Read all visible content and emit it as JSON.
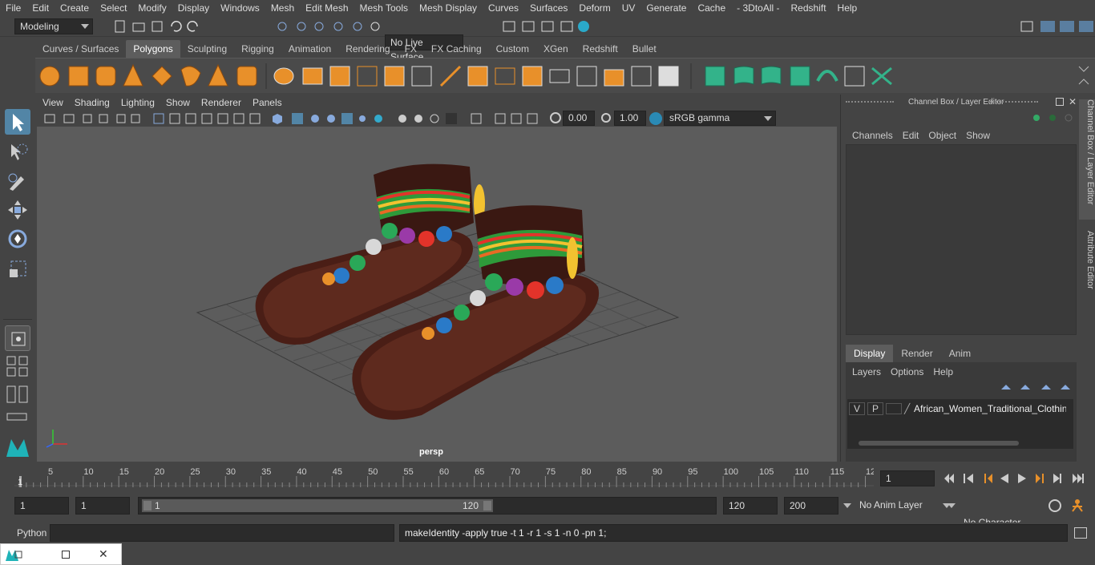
{
  "menubar": {
    "items": [
      "File",
      "Edit",
      "Create",
      "Select",
      "Modify",
      "Display",
      "Windows",
      "Mesh",
      "Edit Mesh",
      "Mesh Tools",
      "Mesh Display",
      "Curves",
      "Surfaces",
      "Deform",
      "UV",
      "Generate",
      "Cache",
      "- 3DtoAll -",
      "Redshift",
      "Help"
    ]
  },
  "status": {
    "mode": "Modeling",
    "live_surface": "No Live Surface"
  },
  "shelf": {
    "tabs": [
      "Curves / Surfaces",
      "Polygons",
      "Sculpting",
      "Rigging",
      "Animation",
      "Rendering",
      "FX",
      "FX Caching",
      "Custom",
      "XGen",
      "Redshift",
      "Bullet"
    ],
    "active_tab": "Polygons"
  },
  "panel": {
    "menus": [
      "View",
      "Shading",
      "Lighting",
      "Show",
      "Renderer",
      "Panels"
    ],
    "exposure": "0.00",
    "gamma": "1.00",
    "colorspace": "sRGB gamma",
    "camera_label": "persp"
  },
  "channel_box": {
    "title": "Channel Box / Layer Editor",
    "menus": [
      "Channels",
      "Edit",
      "Object",
      "Show"
    ],
    "tabs": [
      "Display",
      "Render",
      "Anim"
    ],
    "active_tab": "Display",
    "layer_menus": [
      "Layers",
      "Options",
      "Help"
    ],
    "layer": {
      "v": "V",
      "p": "P",
      "name": "African_Women_Traditional_Clothing"
    }
  },
  "side_tabs": {
    "channel": "Channel Box / Layer Editor",
    "attribute": "Attribute Editor"
  },
  "timeline": {
    "ticks": [
      "5",
      "10",
      "15",
      "20",
      "25",
      "30",
      "35",
      "40",
      "45",
      "50",
      "55",
      "60",
      "65",
      "70",
      "75",
      "80",
      "85",
      "90",
      "95",
      "100",
      "105",
      "110",
      "115",
      "12"
    ],
    "start_label": "1",
    "current_frame": "1"
  },
  "range": {
    "start": "1",
    "start2": "1",
    "slider_start": "1",
    "slider_end": "120",
    "end": "120",
    "end2": "200",
    "anim_layer": "No Anim Layer",
    "char_set": "No Character Set"
  },
  "cmd": {
    "lang": "Python",
    "output": "makeIdentity -apply true -t 1 -r 1 -s 1 -n 0 -pn 1;"
  },
  "colors": {
    "accent": "#5285a6",
    "shelf_icon": "#e8902a",
    "viewport": "#5c5c5c"
  }
}
